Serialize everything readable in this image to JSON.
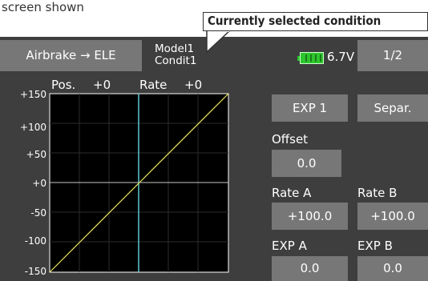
{
  "caption": "screen shown",
  "callout": "Currently selected condition",
  "header": {
    "title": "Airbrake → ELE",
    "model_line1": "Model1",
    "model_line2": "Condit1",
    "battery_icon": "battery-icon",
    "voltage": "6.7V",
    "page": "1/2"
  },
  "graph": {
    "pos_label": "Pos.",
    "pos_value": "+0",
    "rate_label": "Rate",
    "rate_value": "+0",
    "y_ticks": [
      "+150",
      "+100",
      "+50",
      "+0",
      "-50",
      "-100",
      "-150"
    ]
  },
  "controls": {
    "exp1": "EXP 1",
    "separ": "Separ.",
    "offset_label": "Offset",
    "offset_value": "0.0",
    "rate_a_label": "Rate A",
    "rate_a_value": "+100.0",
    "rate_b_label": "Rate B",
    "rate_b_value": "+100.0",
    "exp_a_label": "EXP A",
    "exp_a_value": "0.0",
    "exp_b_label": "EXP B",
    "exp_b_value": "0.0"
  },
  "colors": {
    "screen_bg": "#3e3e3e",
    "button_bg": "#777777",
    "curve": "#e8e85a",
    "cursor": "#5ec8d0",
    "battery": "#2ec62e"
  }
}
